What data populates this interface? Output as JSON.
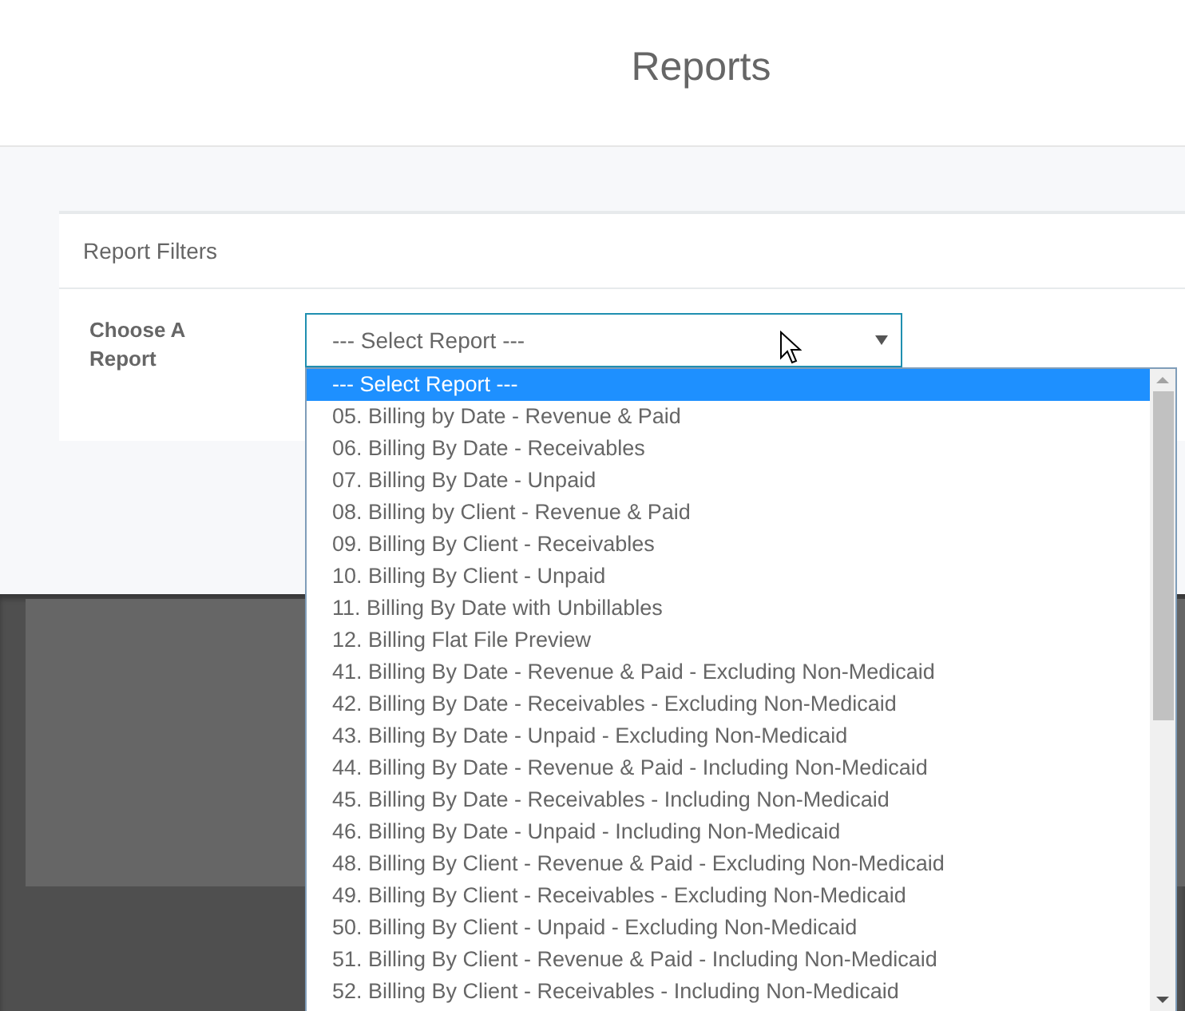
{
  "header": {
    "title": "Reports"
  },
  "filters": {
    "title": "Report Filters",
    "label": "Choose A Report",
    "select": {
      "value": "--- Select Report ---",
      "expanded": true
    },
    "options": [
      {
        "label": "--- Select Report ---",
        "selected": true
      },
      {
        "label": "05. Billing by Date - Revenue & Paid",
        "selected": false
      },
      {
        "label": "06. Billing By Date - Receivables",
        "selected": false
      },
      {
        "label": "07. Billing By Date - Unpaid",
        "selected": false
      },
      {
        "label": "08. Billing by Client - Revenue & Paid",
        "selected": false
      },
      {
        "label": "09. Billing By Client - Receivables",
        "selected": false
      },
      {
        "label": "10. Billing By Client - Unpaid",
        "selected": false
      },
      {
        "label": "11. Billing By Date with Unbillables",
        "selected": false
      },
      {
        "label": "12. Billing Flat File Preview",
        "selected": false
      },
      {
        "label": "41. Billing By Date - Revenue & Paid - Excluding Non-Medicaid",
        "selected": false
      },
      {
        "label": "42. Billing By Date - Receivables - Excluding Non-Medicaid",
        "selected": false
      },
      {
        "label": "43. Billing By Date - Unpaid - Excluding Non-Medicaid",
        "selected": false
      },
      {
        "label": "44. Billing By Date - Revenue & Paid - Including Non-Medicaid",
        "selected": false
      },
      {
        "label": "45. Billing By Date - Receivables - Including Non-Medicaid",
        "selected": false
      },
      {
        "label": "46. Billing By Date - Unpaid - Including Non-Medicaid",
        "selected": false
      },
      {
        "label": "48. Billing By Client - Revenue & Paid - Excluding Non-Medicaid",
        "selected": false
      },
      {
        "label": "49. Billing By Client - Receivables - Excluding Non-Medicaid",
        "selected": false
      },
      {
        "label": "50. Billing By Client - Unpaid - Excluding Non-Medicaid",
        "selected": false
      },
      {
        "label": "51. Billing By Client - Revenue & Paid - Including Non-Medicaid",
        "selected": false
      },
      {
        "label": "52. Billing By Client - Receivables - Including Non-Medicaid",
        "selected": false
      }
    ]
  }
}
